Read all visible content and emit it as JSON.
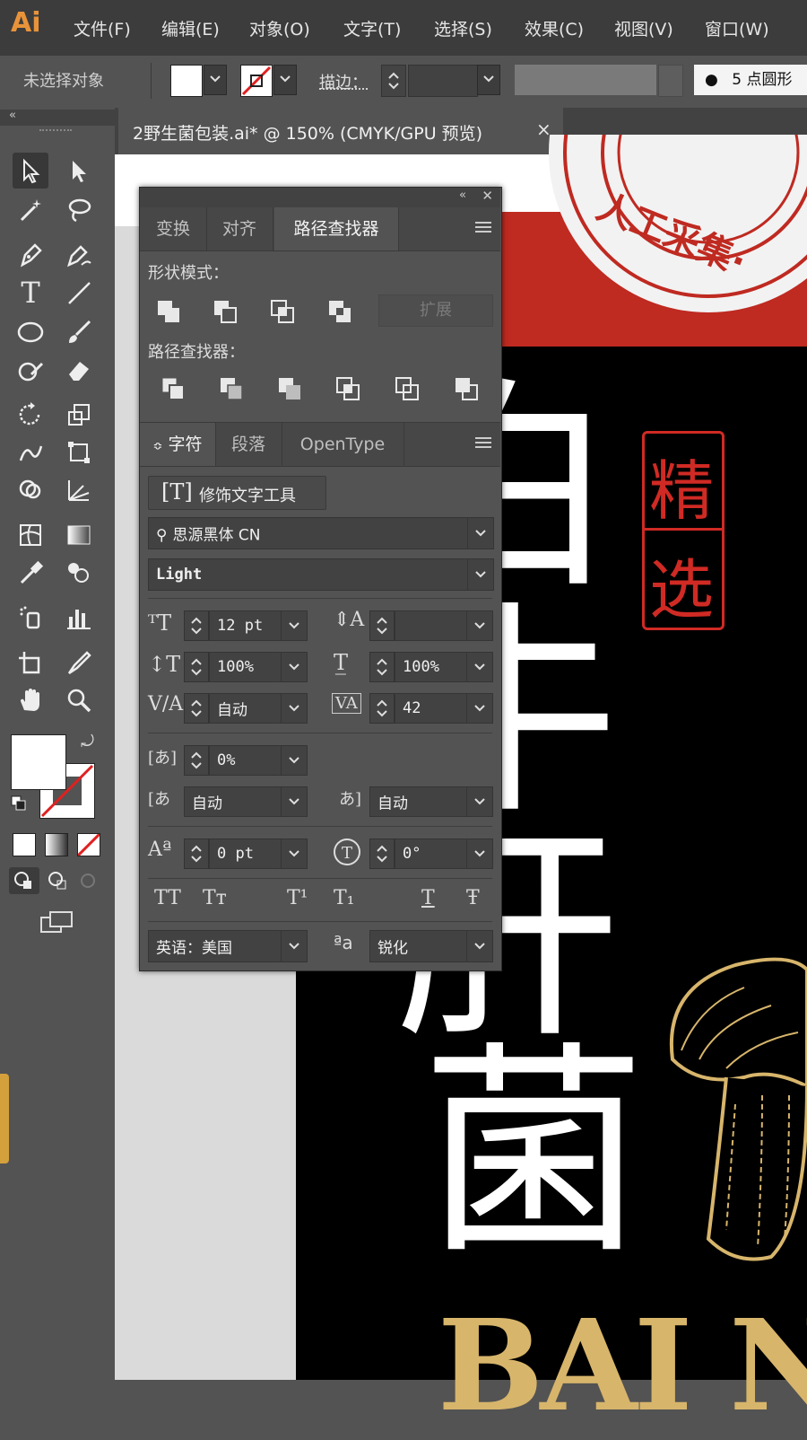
{
  "app": {
    "logo": "Ai"
  },
  "menu": [
    "文件(F)",
    "编辑(E)",
    "对象(O)",
    "文字(T)",
    "选择(S)",
    "效果(C)",
    "视图(V)",
    "窗口(W)"
  ],
  "control_bar": {
    "selection_status": "未选择对象",
    "stroke_label": "描边：",
    "brush_label": "5 点圆形"
  },
  "document": {
    "tab_title": "2野生菌包装.ai* @ 150% (CMYK/GPU 预览)",
    "close": "×"
  },
  "panel": {
    "tabs_top": [
      "变换",
      "对齐",
      "路径查找器"
    ],
    "shape_modes_label": "形状模式：",
    "expand_label": "扩展",
    "pathfinder_label": "路径查找器：",
    "tabs_bottom": [
      "字符",
      "段落",
      "OpenType"
    ],
    "touch_type_label": "修饰文字工具",
    "font_family": "思源黑体 CN",
    "font_style": "Light",
    "font_size": "12 pt",
    "leading": "",
    "vertical_scale": "100%",
    "horizontal_scale": "100%",
    "kerning": "自动",
    "tracking": "42",
    "tsume": "0%",
    "aki_left": "自动",
    "aki_right": "自动",
    "baseline_shift": "0 pt",
    "rotation": "0°",
    "format_buttons": [
      "TT",
      "Tт",
      "T¹",
      "T₁",
      "T",
      "Ŧ"
    ],
    "language": "英语：美国",
    "antialias_label": "ªa",
    "antialias": "锐化"
  },
  "artwork": {
    "stamp_text": "人工采集·",
    "badge": [
      "精",
      "选"
    ],
    "title_chars": [
      "白",
      "牛",
      "肝",
      "菌"
    ],
    "brand_text": "BAI N",
    "colors": {
      "red": "#bf2a21",
      "gold": "#d7b56b",
      "black": "#000000"
    }
  }
}
